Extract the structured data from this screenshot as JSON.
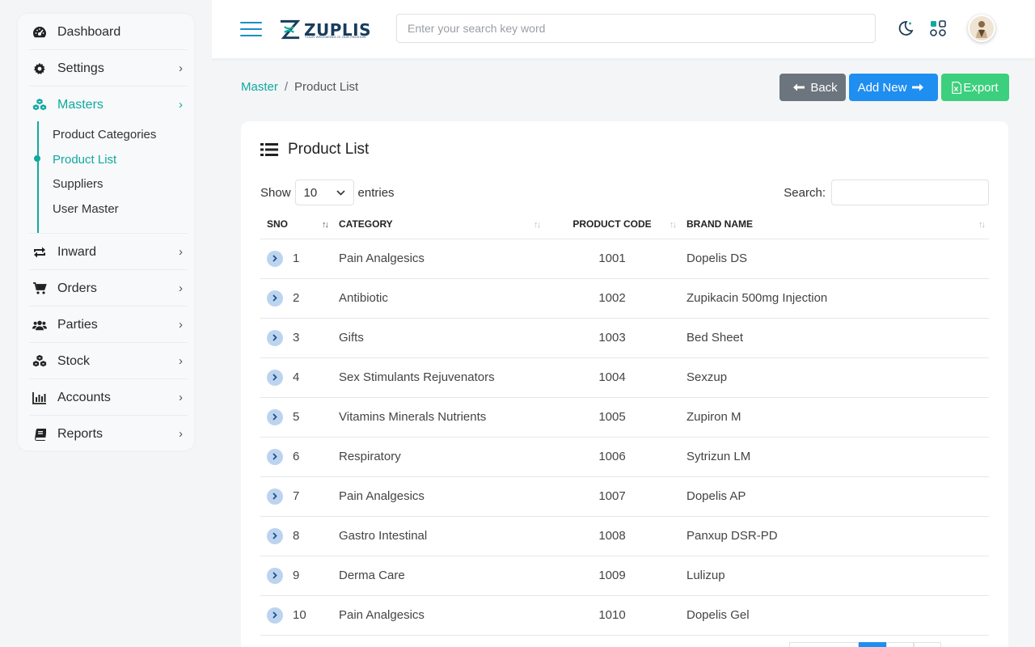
{
  "sidebar": {
    "items": [
      {
        "label": "Dashboard",
        "icon": "dashboard-icon"
      },
      {
        "label": "Settings",
        "icon": "gear-icon"
      },
      {
        "label": "Masters",
        "icon": "cubes-icon"
      },
      {
        "label": "Inward",
        "icon": "exchange-icon"
      },
      {
        "label": "Orders",
        "icon": "cart-icon"
      },
      {
        "label": "Parties",
        "icon": "users-icon"
      },
      {
        "label": "Stock",
        "icon": "cubes-icon"
      },
      {
        "label": "Accounts",
        "icon": "bar-chart-icon"
      },
      {
        "label": "Reports",
        "icon": "book-icon"
      }
    ],
    "masters_sub": [
      "Product Categories",
      "Product List",
      "Suppliers",
      "User Master"
    ],
    "chevron": "›"
  },
  "header": {
    "brand": "ZUPLIS",
    "tagline": "YOUR WELLBEING IS OUR PASSION",
    "search_placeholder": "Enter your search key word"
  },
  "breadcrumb": {
    "parent": "Master",
    "separator": "/",
    "current": "Product List"
  },
  "buttons": {
    "back": "Back",
    "add_new": "Add New",
    "export": "Export"
  },
  "card": {
    "title": "Product List",
    "show_label": "Show",
    "entries_value": "10",
    "entries_label": "entries",
    "search_label": "Search:"
  },
  "table": {
    "columns": [
      "SNO",
      "CATEGORY",
      "PRODUCT CODE",
      "BRAND NAME"
    ],
    "rows": [
      {
        "sno": "1",
        "category": "Pain Analgesics",
        "code": "1001",
        "brand": "Dopelis DS"
      },
      {
        "sno": "2",
        "category": "Antibiotic",
        "code": "1002",
        "brand": "Zupikacin 500mg Injection"
      },
      {
        "sno": "3",
        "category": "Gifts",
        "code": "1003",
        "brand": "Bed Sheet"
      },
      {
        "sno": "4",
        "category": "Sex Stimulants Rejuvenators",
        "code": "1004",
        "brand": "Sexzup"
      },
      {
        "sno": "5",
        "category": "Vitamins Minerals Nutrients",
        "code": "1005",
        "brand": "Zupiron M"
      },
      {
        "sno": "6",
        "category": "Respiratory",
        "code": "1006",
        "brand": "Sytrizun LM"
      },
      {
        "sno": "7",
        "category": "Pain Analgesics",
        "code": "1007",
        "brand": "Dopelis AP"
      },
      {
        "sno": "8",
        "category": "Gastro Intestinal",
        "code": "1008",
        "brand": "Panxup DSR-PD"
      },
      {
        "sno": "9",
        "category": "Derma Care",
        "code": "1009",
        "brand": "Lulizup"
      },
      {
        "sno": "10",
        "category": "Pain Analgesics",
        "code": "1010",
        "brand": "Dopelis Gel"
      }
    ]
  },
  "colors": {
    "accent": "#10a9a0",
    "primary": "#1f8ef1",
    "success": "#3ccf7d",
    "secondary": "#6c757d"
  }
}
